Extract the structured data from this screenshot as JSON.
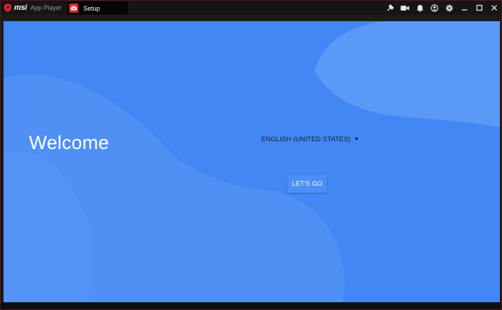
{
  "app": {
    "brand_logo": "msi",
    "brand_name": "App Player"
  },
  "tab": {
    "label": "Setup",
    "icon": "setup-app-icon"
  },
  "window_controls": {
    "icons": [
      "keymap-icon",
      "video-icon",
      "bell-icon",
      "account-icon",
      "gear-icon",
      "minimize-icon",
      "maximize-icon",
      "close-icon"
    ]
  },
  "setup": {
    "welcome": "Welcome",
    "language": "ENGLISH (UNITED STATES)",
    "go_label": "LET'S GO"
  },
  "colors": {
    "background": "#4387f4",
    "accent": "#d8262c"
  }
}
